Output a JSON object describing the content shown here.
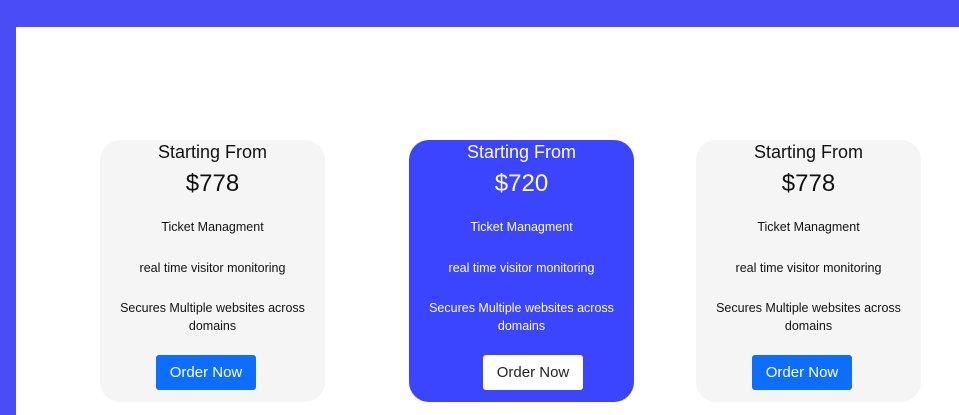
{
  "plans": [
    {
      "heading": "Starting From",
      "price": "$778",
      "features": [
        "Ticket Managment",
        "real time visitor monitoring",
        "Secures Multiple websites across domains"
      ],
      "button_label": "Order Now"
    },
    {
      "heading": "Starting From",
      "price": "$720",
      "features": [
        "Ticket Managment",
        "real time visitor monitoring",
        "Secures Multiple websites across domains"
      ],
      "button_label": "Order Now"
    },
    {
      "heading": "Starting From",
      "price": "$778",
      "features": [
        "Ticket Managment",
        "real time visitor monitoring",
        "Secures Multiple websites across domains"
      ],
      "button_label": "Order Now"
    }
  ],
  "colors": {
    "frame": "#4a4cf5",
    "highlight_card": "#3b44fe",
    "card": "#f5f5f5",
    "button": "#0d6efd"
  }
}
